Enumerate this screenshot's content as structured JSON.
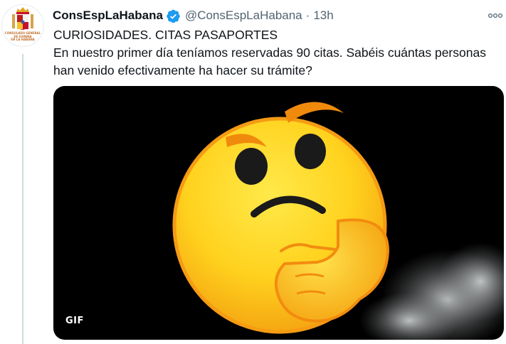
{
  "account": {
    "display_name": "ConsEspLaHabana",
    "handle": "@ConsEspLaHabana",
    "separator": "·",
    "time": "13h",
    "avatar_text": "CONSULADO GENERAL\nDE ESPAÑA\nEN LA HABANA"
  },
  "tweet": {
    "lines": [
      "CURIOSIDADES. CITAS PASAPORTES",
      "En nuestro primer día teníamos reservadas 90 citas. Sabéis cuántas personas",
      "han venido efectivamente ha hacer su trámite?"
    ]
  },
  "media": {
    "badge": "GIF",
    "icon": "thinking-face-emoji"
  },
  "icons": {
    "verified": "verified-badge-icon",
    "more": "more-options-icon"
  },
  "colors": {
    "verified": "#1d9bf0",
    "secondary_text": "#536471",
    "thread_line": "#cfd9de",
    "emoji_yellow": "#ffd21e",
    "emoji_orange": "#f59b14"
  }
}
